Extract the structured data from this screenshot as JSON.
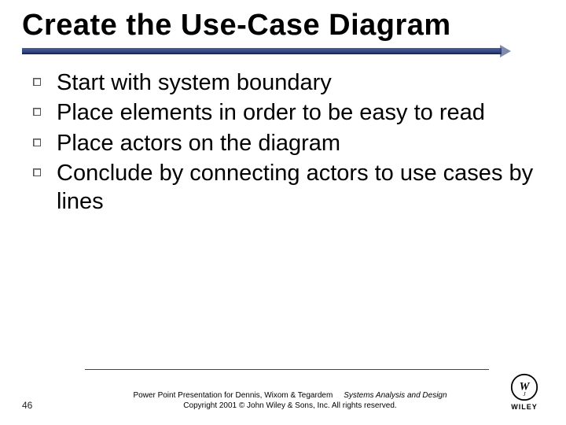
{
  "title": "Create the Use-Case Diagram",
  "bullets": [
    "Start with system boundary",
    "Place elements in order to be easy to read",
    "Place actors on the diagram",
    "Conclude by connecting actors to use cases by lines"
  ],
  "footer": {
    "page": "46",
    "line1_a": "Power Point Presentation for Dennis, Wixom & Tegardem",
    "line1_b": "Systems Analysis and Design",
    "line2": "Copyright 2001 © John Wiley & Sons, Inc.  All rights reserved.",
    "brand": "WILEY"
  }
}
